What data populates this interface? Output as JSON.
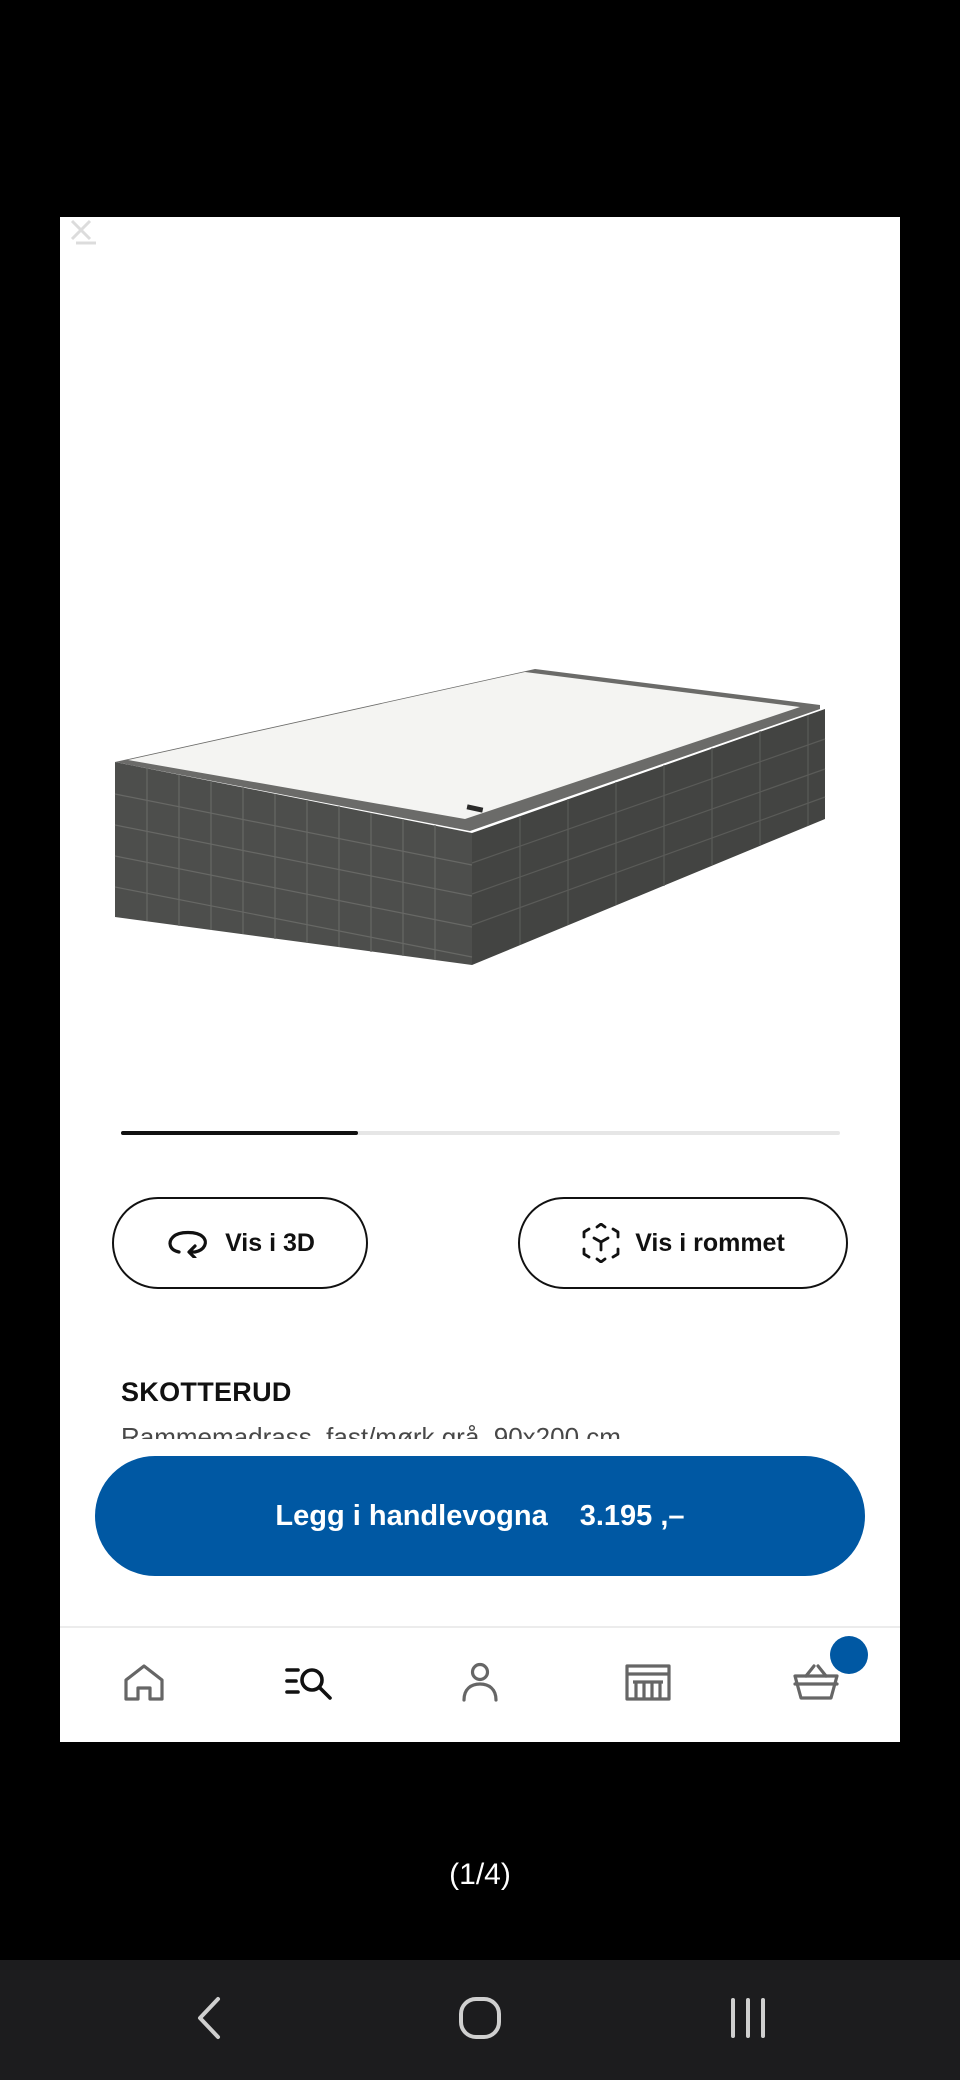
{
  "viewer": {
    "page_counter": "(1/4)"
  },
  "gallery": {
    "current_image": 1,
    "total_images": 4,
    "progress_fraction": 0.33
  },
  "actions": {
    "view_3d_label": "Vis i 3D",
    "view_in_room_label": "Vis i rommet"
  },
  "product": {
    "name": "SKOTTERUD",
    "description": "Rammemadrass, fast/mørk grå, 90x200 cm"
  },
  "cart_button": {
    "label": "Legg i handlevogna",
    "price": "3.195 ,–"
  },
  "bottom_nav": {
    "items": [
      {
        "icon": "home-icon"
      },
      {
        "icon": "search-icon"
      },
      {
        "icon": "profile-icon"
      },
      {
        "icon": "store-icon"
      },
      {
        "icon": "cart-icon"
      }
    ]
  },
  "colors": {
    "brand_blue": "#0058a3",
    "text_dark": "#111111",
    "mattress_grey": "#4a4b4a"
  }
}
